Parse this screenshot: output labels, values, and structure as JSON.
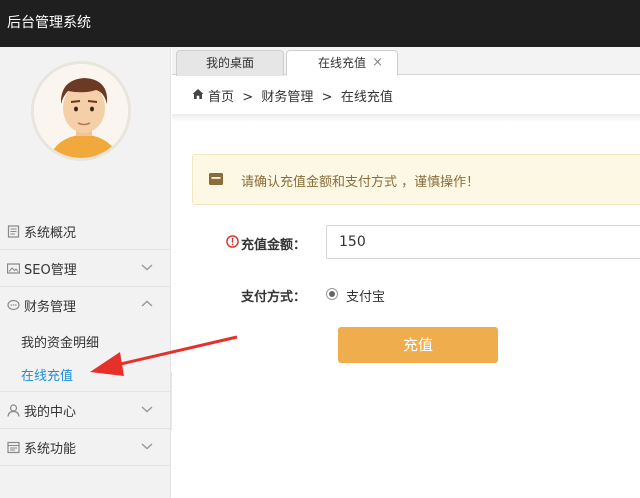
{
  "app": {
    "title": "后台管理系统"
  },
  "sidebar": {
    "items": [
      {
        "label": "系统概况",
        "icon": "document-icon"
      },
      {
        "label": "SEO管理",
        "icon": "image-icon",
        "chevron": "down"
      },
      {
        "label": "财务管理",
        "icon": "chat-icon",
        "chevron": "up",
        "expanded": true,
        "children": [
          {
            "label": "我的资金明细"
          },
          {
            "label": "在线充值",
            "active": true
          }
        ]
      },
      {
        "label": "我的中心",
        "icon": "user-icon",
        "chevron": "down"
      },
      {
        "label": "系统功能",
        "icon": "window-icon",
        "chevron": "down"
      }
    ]
  },
  "tabs": [
    {
      "label": "我的桌面"
    },
    {
      "label": "在线充值",
      "close": "×",
      "active": true
    }
  ],
  "breadcrumb": {
    "text": "首页  >  财务管理  >  在线充值"
  },
  "alert": {
    "text": "请确认充值金额和支付方式 ，谨慎操作！"
  },
  "form": {
    "amount_label": "充值金额：",
    "amount_value": "150",
    "payment_label": "支付方式：",
    "payment_option": "支付宝",
    "submit_label": "充值"
  },
  "colors": {
    "topbar": "#1f1f1f",
    "accent_link": "#1e8fd6",
    "button": "#f0ad4e",
    "annotation_arrow": "#e8302a"
  }
}
